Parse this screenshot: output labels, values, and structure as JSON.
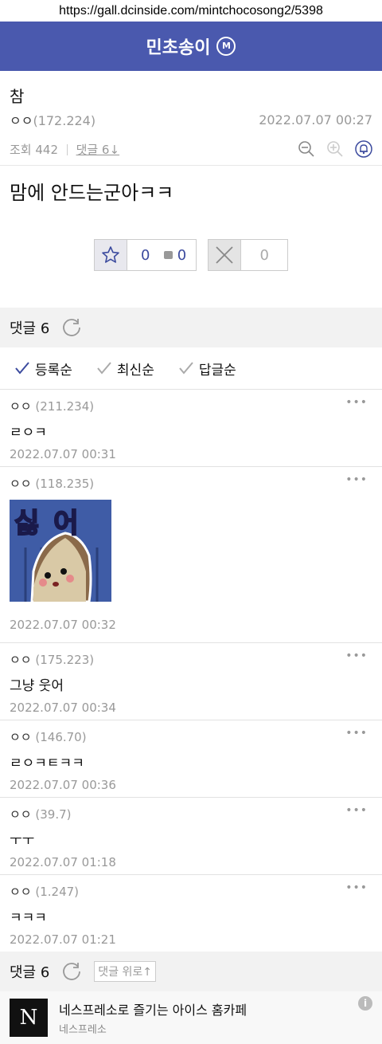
{
  "browser": {
    "url": "https://gall.dcinside.com/mintchocosong2/5398"
  },
  "header": {
    "title": "민초송이",
    "badge": "M"
  },
  "post": {
    "title": "참",
    "author_name": "ㅇㅇ",
    "author_ip": "(172.224)",
    "date": "2022.07.07 00:27",
    "views_label": "조회 442",
    "comments_label": "댓글 6",
    "body": "맘에 안드는군아ㅋㅋ"
  },
  "votes": {
    "up": "0",
    "mini": "0",
    "down": "0"
  },
  "comments_bar": {
    "label": "댓글 6"
  },
  "sort": {
    "items": [
      "등록순",
      "최신순",
      "답글순"
    ]
  },
  "comments": [
    {
      "name": "ㅇㅇ",
      "ip": "(211.234)",
      "text": "ㄹㅇㅋ",
      "date": "2022.07.07 00:31"
    },
    {
      "name": "ㅇㅇ",
      "ip": "(118.235)",
      "sticker_text": "싫어",
      "date": "2022.07.07 00:32"
    },
    {
      "name": "ㅇㅇ",
      "ip": "(175.223)",
      "text": "그냥 웃어",
      "date": "2022.07.07 00:34"
    },
    {
      "name": "ㅇㅇ",
      "ip": "(146.70)",
      "text": "ㄹㅇㅋㅌㅋㅋ",
      "date": "2022.07.07 00:36"
    },
    {
      "name": "ㅇㅇ",
      "ip": "(39.7)",
      "text": "ㅜㅜ",
      "date": "2022.07.07 01:18"
    },
    {
      "name": "ㅇㅇ",
      "ip": "(1.247)",
      "text": "ㅋㅋㅋ",
      "date": "2022.07.07 01:21"
    }
  ],
  "bottom_bar": {
    "label": "댓글 6",
    "up_label": "댓글 위로↑"
  },
  "ad": {
    "logo_letter": "N",
    "title": "네스프레소로 즐기는 아이스 홈카페",
    "sponsor": "네스프레소",
    "info": "i"
  },
  "colors": {
    "brand": "#4a59ae",
    "check": "#3b4a9e"
  }
}
